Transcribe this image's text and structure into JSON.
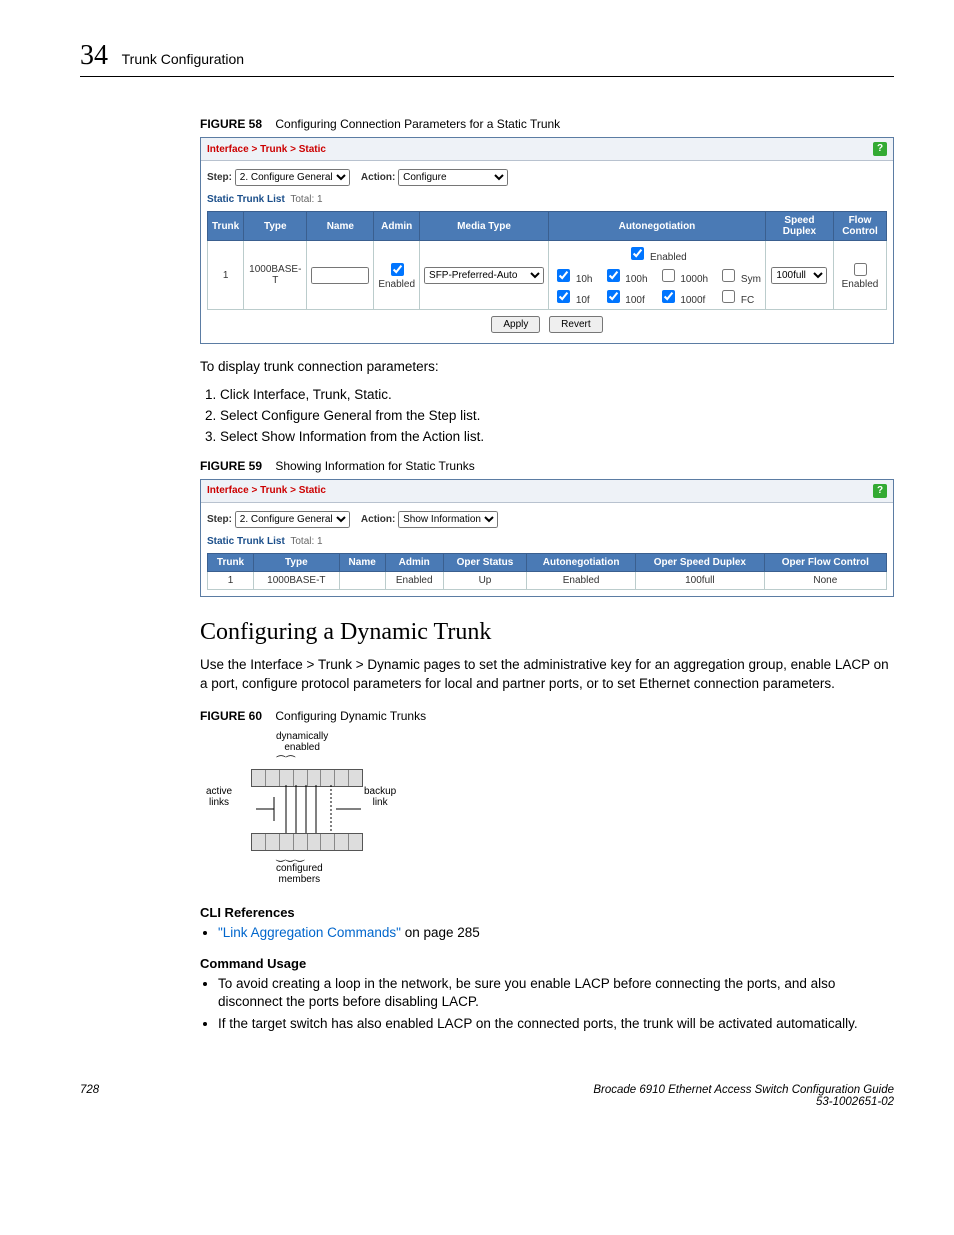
{
  "header": {
    "chapter_num": "34",
    "chapter_title": "Trunk Configuration"
  },
  "fig58": {
    "label": "FIGURE 58",
    "title": "Configuring Connection Parameters for a Static Trunk",
    "breadcrumb": "Interface > Trunk > Static",
    "step_label": "Step:",
    "step_value": "2. Configure General",
    "action_label": "Action:",
    "action_value": "Configure",
    "list_title": "Static Trunk List",
    "list_total_label": "Total:",
    "list_total": "1",
    "headers": {
      "trunk": "Trunk",
      "type": "Type",
      "name": "Name",
      "admin": "Admin",
      "media": "Media Type",
      "autoneg": "Autonegotiation",
      "speed": "Speed Duplex",
      "flow": "Flow Control"
    },
    "row": {
      "trunk": "1",
      "type": "1000BASE-T",
      "name": "",
      "admin_label": "Enabled",
      "media_value": "SFP-Preferred-Auto",
      "autoneg_enabled": "Enabled",
      "caps": {
        "c10h": "10h",
        "c10f": "10f",
        "c100h": "100h",
        "c100f": "100f",
        "c1000h": "1000h",
        "c1000f": "1000f",
        "sym": "Sym",
        "fc": "FC"
      },
      "speed_value": "100full",
      "flow_label": "Enabled"
    },
    "btn_apply": "Apply",
    "btn_revert": "Revert"
  },
  "intro59": "To display trunk connection parameters:",
  "steps59": [
    "Click Interface, Trunk, Static.",
    "Select Configure General from the Step list.",
    "Select Show Information from the Action list."
  ],
  "fig59": {
    "label": "FIGURE 59",
    "title": "Showing Information for Static Trunks",
    "breadcrumb": "Interface > Trunk > Static",
    "step_label": "Step:",
    "step_value": "2. Configure General",
    "action_label": "Action:",
    "action_value": "Show Information",
    "list_title": "Static Trunk List",
    "list_total_label": "Total:",
    "list_total": "1",
    "headers": {
      "trunk": "Trunk",
      "type": "Type",
      "name": "Name",
      "admin": "Admin",
      "oper": "Oper Status",
      "autoneg": "Autonegotiation",
      "speed": "Oper Speed Duplex",
      "flow": "Oper Flow Control"
    },
    "row": {
      "trunk": "1",
      "type": "1000BASE-T",
      "name": "",
      "admin": "Enabled",
      "oper": "Up",
      "autoneg": "Enabled",
      "speed": "100full",
      "flow": "None"
    }
  },
  "dyn": {
    "heading": "Configuring a Dynamic Trunk",
    "para": "Use the Interface > Trunk > Dynamic pages to set the administrative key for an aggregation group, enable LACP on a port, configure protocol parameters for local and partner ports, or to set Ethernet connection parameters."
  },
  "fig60": {
    "label": "FIGURE 60",
    "title": "Configuring Dynamic Trunks",
    "lbl_dyn": "dynamically\nenabled",
    "lbl_active": "active\nlinks",
    "lbl_backup": "backup\nlink",
    "lbl_conf": "configured\nmembers"
  },
  "cli": {
    "heading": "CLI References",
    "link_text": "\"Link Aggregation Commands\"",
    "link_suffix": " on page 285"
  },
  "usage": {
    "heading": "Command Usage",
    "items": [
      "To avoid creating a loop in the network, be sure you enable LACP before connecting the ports, and also disconnect the ports before disabling LACP.",
      "If the target switch has also enabled LACP on the connected ports, the trunk will be activated automatically."
    ]
  },
  "footer": {
    "page": "728",
    "book": "Brocade 6910 Ethernet Access Switch Configuration Guide",
    "docnum": "53-1002651-02"
  }
}
